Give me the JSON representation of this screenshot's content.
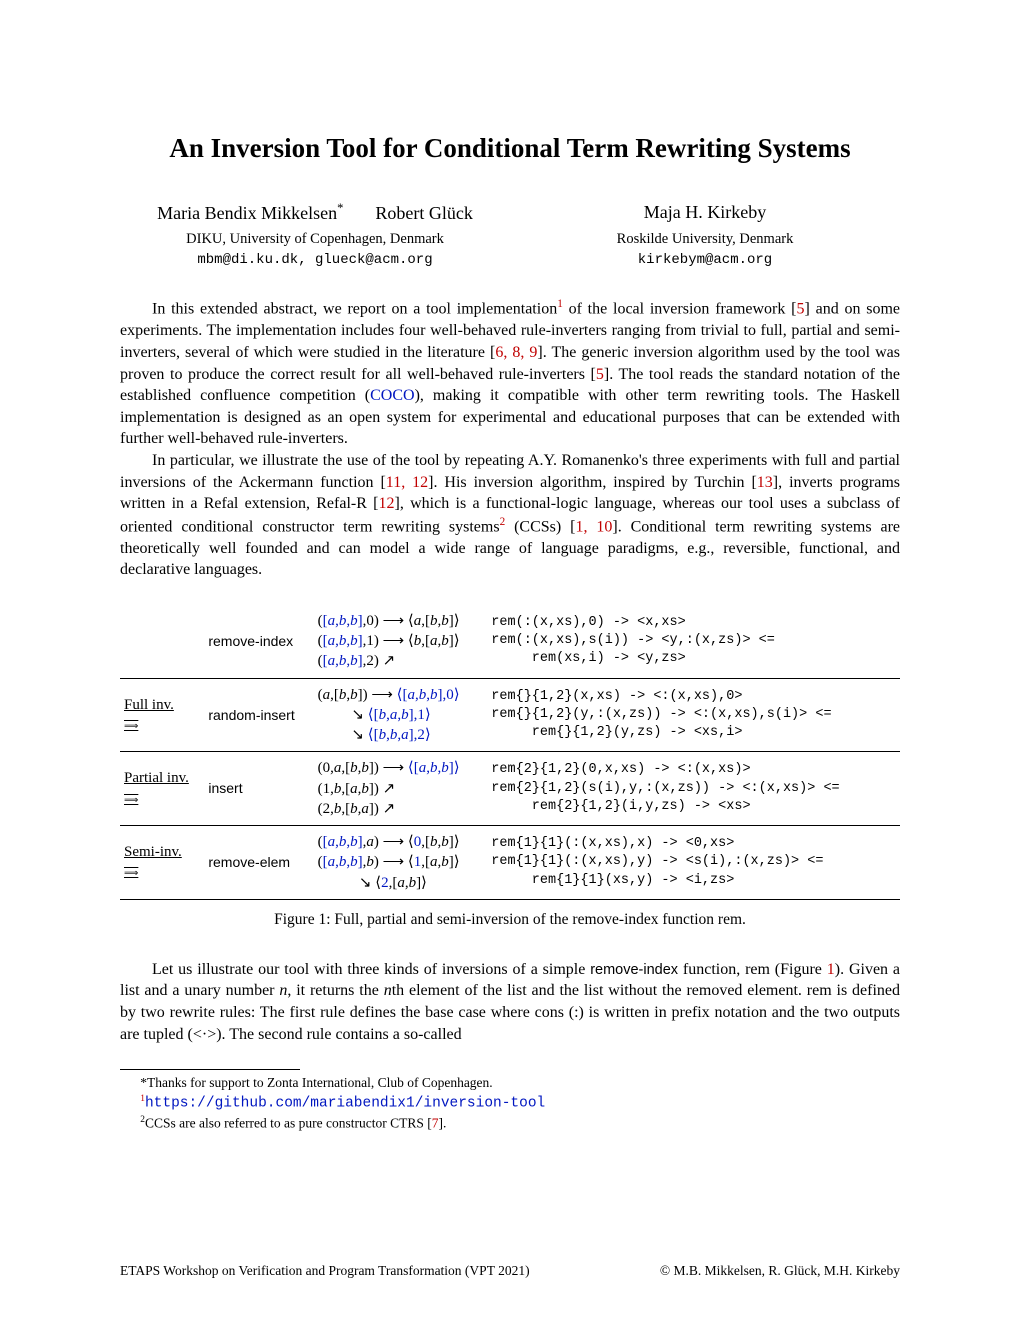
{
  "title": "An Inversion Tool for Conditional Term Rewriting Systems",
  "authors": [
    {
      "name": "Maria Bendix Mikkelsen",
      "note": "*"
    },
    {
      "name": "Robert Glück",
      "note": ""
    },
    {
      "name": "Maja H. Kirkeby",
      "note": ""
    }
  ],
  "affiliations": [
    {
      "org": "DIKU, University of Copenhagen, Denmark",
      "email": "mbm@di.ku.dk, glueck@acm.org"
    },
    {
      "org": "Roskilde University, Denmark",
      "email": "kirkebym@acm.org"
    }
  ],
  "para1_a": "In this extended abstract, we report on a tool implementation",
  "para1_b": " of the local inversion framework [",
  "para1_c": "] and on some experiments. The implementation includes four well-behaved rule-inverters ranging from trivial to full, partial and semi-inverters, several of which were studied in the literature [",
  "para1_d": "]. The generic inversion algorithm used by the tool was proven to produce the correct result for all well-behaved rule-inverters [",
  "para1_e": "]. The tool reads the standard notation of the established confluence competition (",
  "para1_f": "), making it compatible with other term rewriting tools. The Haskell implementation is designed as an open system for experimental and educational purposes that can be extended with further well-behaved rule-inverters.",
  "cite5": "5",
  "cite689": "6, 8, 9",
  "coco": "COCO",
  "para2_a": "In particular, we illustrate the use of the tool by repeating A.Y. Romanenko's three experiments with full and partial inversions of the Ackermann function [",
  "para2_b": "]. His inversion algorithm, inspired by Turchin [",
  "para2_c": "], inverts programs written in a Refal extension, Refal-R [",
  "para2_d": "], which is a functional-logic language, whereas our tool uses a subclass of oriented conditional constructor term rewriting systems",
  "para2_e": " (CCSs) [",
  "para2_f": "]. Conditional term rewriting systems are theoretically well founded and can model a wide range of language paradigms, e.g., reversible, functional, and declarative languages.",
  "cite1112": "11, 12",
  "cite13": "13",
  "cite12": "12",
  "cite110": "1, 10",
  "figure": {
    "caption": "Figure 1: Full, partial and semi-inversion of the remove-index function rem.",
    "rows": [
      {
        "inv_label": "",
        "sec": "remove-index",
        "math": [
          "([a,b,b],0) ⟶ ⟨a,[b,b]⟩",
          "([a,b,b],1) ⟶ ⟨b,[a,b]⟩",
          "([a,b,b],2) ↗"
        ],
        "code": [
          "rem(:(x,xs),0) -> <x,xs>",
          "rem(:(x,xs),s(i)) -> <y,:(x,zs)> <=",
          "    rem(xs,i) -> <y,zs>"
        ]
      },
      {
        "inv_label": "Full inv.",
        "sec": "random-insert",
        "math": [
          "(a,[b,b]) ⟶ ⟨[a,b,b],0⟩",
          "         ↘ ⟨[b,a,b],1⟩",
          "         ↘ ⟨[b,b,a],2⟩"
        ],
        "code": [
          "rem{}{1,2}(x,xs) -> <:(x,xs),0>",
          "rem{}{1,2}(y,:(x,zs)) -> <:(x,xs),s(i)> <=",
          "    rem{}{1,2}(y,zs) -> <xs,i>"
        ]
      },
      {
        "inv_label": "Partial inv.",
        "sec": "insert",
        "math": [
          "(0,a,[b,b]) ⟶ ⟨[a,b,b]⟩",
          "(1,b,[a,b]) ↗",
          "(2,b,[b,a]) ↗"
        ],
        "code": [
          "rem{2}{1,2}(0,x,xs) -> <:(x,xs)>",
          "rem{2}{1,2}(s(i),y,:(x,zs)) -> <:(x,xs)> <=",
          "    rem{2}{1,2}(i,y,zs) -> <xs>"
        ]
      },
      {
        "inv_label": "Semi-inv.",
        "sec": "remove-elem",
        "math": [
          "([a,b,b],a) ⟶ ⟨0,[b,b]⟩",
          "([a,b,b],b) ⟶ ⟨1,[a,b]⟩",
          "           ↘ ⟨2,[a,b]⟩"
        ],
        "code": [
          "rem{1}{1}(:(x,xs),x) -> <0,xs>",
          "rem{1}{1}(:(x,xs),y) -> <s(i),:(x,zs)> <=",
          "    rem{1}{1}(xs,y) -> <i,zs>"
        ]
      }
    ]
  },
  "para3_a": "Let us illustrate our tool with three kinds of inversions of a simple ",
  "para3_b": "remove-index",
  "para3_c": " function, rem (Figure ",
  "para3_d": "). Given a list and a unary number ",
  "para3_e": ", it returns the ",
  "para3_f": "th element of the list and the list without the removed element. rem is defined by two rewrite rules: The first rule defines the base case where cons (:) is written in prefix notation and the two outputs are tupled (<·>). The second rule contains a so-called",
  "fig_ref": "1",
  "var_n": "n",
  "footnotes": {
    "star": "*Thanks for support to Zonta International, Club of Copenhagen.",
    "f1_label": "1",
    "f1_url": "https://github.com/mariabendix1/inversion-tool",
    "f2_label": "2",
    "f2_text": "CCSs are also referred to as pure constructor CTRS [",
    "f2_cite": "7",
    "f2_end": "]."
  },
  "footer": {
    "left": "ETAPS Workshop on Verification and Program Transformation (VPT 2021)",
    "right": "© M.B. Mikkelsen, R. Glück, M.H. Kirkeby"
  }
}
